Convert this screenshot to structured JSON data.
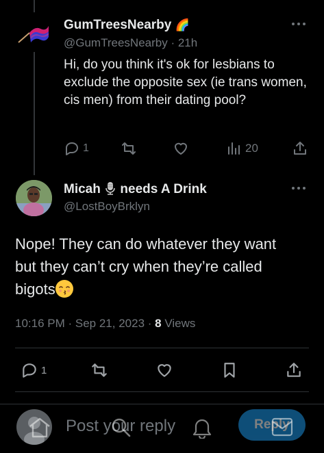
{
  "tweet1": {
    "name": "GumTreesNearby",
    "name_emoji": "🌈",
    "handle": "@GumTreesNearby",
    "time": "· 21h",
    "text": "Hi, do you think it's ok for lesbians to exclude the opposite sex (ie trans women, cis men) from their dating pool?",
    "replies": "1",
    "retweets": "",
    "likes": "",
    "views": "20"
  },
  "tweet2": {
    "name_part1": "Micah",
    "name_part2": "needs A Drink",
    "handle": "@LostBoyBrklyn",
    "text_line1": "Nope! They can do whatever they want",
    "text_line2": "but they can’t cry when they’re called",
    "text_line3": "bigots",
    "time": "10:16 PM · Sep 21, 2023 ·",
    "views_count": "8",
    "views_label": "Views",
    "replies": "1"
  },
  "reply_bar": {
    "placeholder": "Post your reply",
    "button": "Reply"
  },
  "colors": {
    "accent": "#1d9bf0",
    "muted": "#71767b",
    "text": "#e7e9ea",
    "background": "#000000"
  }
}
